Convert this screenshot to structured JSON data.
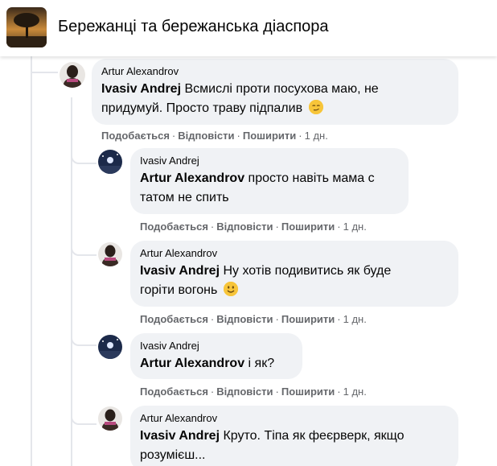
{
  "header": {
    "group_title": "Бережанці та бережанська діаспора"
  },
  "actions": {
    "like": "Подобається",
    "reply": "Відповісти",
    "share": "Поширити",
    "separator": "·"
  },
  "comments": [
    {
      "author": "Artur Alexandrov",
      "mention": "Ivasiv Andrej",
      "text_line1": " Всмислі проти посухова маю, не",
      "text_line2": "придумуй. Просто траву підпалив",
      "emoji": "smirk-emoji",
      "time": "1 дн."
    },
    {
      "author": "Ivasiv Andrej",
      "mention": "Artur Alexandrov",
      "text_line1": " просто навіть мама с",
      "text_line2": "татом не спить",
      "time": "1 дн."
    },
    {
      "author": "Artur Alexandrov",
      "mention": "Ivasiv Andrej",
      "text_line1": " Ну хотів подивитись як буде",
      "text_line2": "горіти вогонь",
      "emoji": "smile-emoji",
      "time": "1 дн."
    },
    {
      "author": "Ivasiv Andrej",
      "mention": "Artur Alexandrov",
      "text_line1": " і як?",
      "time": "1 дн."
    },
    {
      "author": "Artur Alexandrov",
      "mention": "Ivasiv Andrej",
      "text_line1": " Круто. Тіпа як феєрверк, якщо",
      "text_line2": "розумієш..."
    }
  ],
  "colors": {
    "bubble": "#f0f2f5",
    "secondary_text": "#65676b",
    "thread_line": "#e4e6eb"
  }
}
